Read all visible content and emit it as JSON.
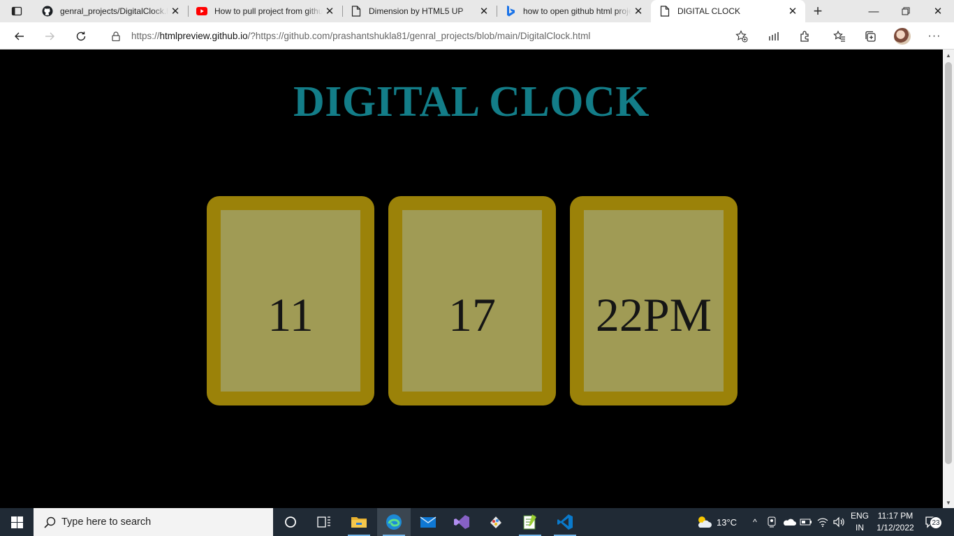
{
  "browser": {
    "tabs": [
      {
        "title": "genral_projects/DigitalClock.html",
        "favicon": "github-icon",
        "active": false
      },
      {
        "title": "How to pull project from github",
        "favicon": "youtube-icon",
        "active": false
      },
      {
        "title": "Dimension by HTML5 UP",
        "favicon": "page-icon",
        "active": false
      },
      {
        "title": "how to open github html project",
        "favicon": "bing-icon",
        "active": false
      },
      {
        "title": "DIGITAL CLOCK",
        "favicon": "page-icon",
        "active": true
      }
    ],
    "url_prefix": "https://",
    "url_host": "htmlpreview.github.io",
    "url_rest": "/?https://github.com/prashantshukla81/genral_projects/blob/main/DigitalClock.html"
  },
  "page": {
    "heading": "DIGITAL CLOCK",
    "hours": "11",
    "minutes": "17",
    "seconds": "22PM",
    "heading_color": "#137d88",
    "box_border_color": "#9b8209",
    "box_fill_color": "#a09b55"
  },
  "taskbar": {
    "search_placeholder": "Type here to search",
    "weather": "13°C",
    "language_line1": "ENG",
    "language_line2": "IN",
    "time": "11:17 PM",
    "date": "1/12/2022",
    "notifications": "23"
  }
}
